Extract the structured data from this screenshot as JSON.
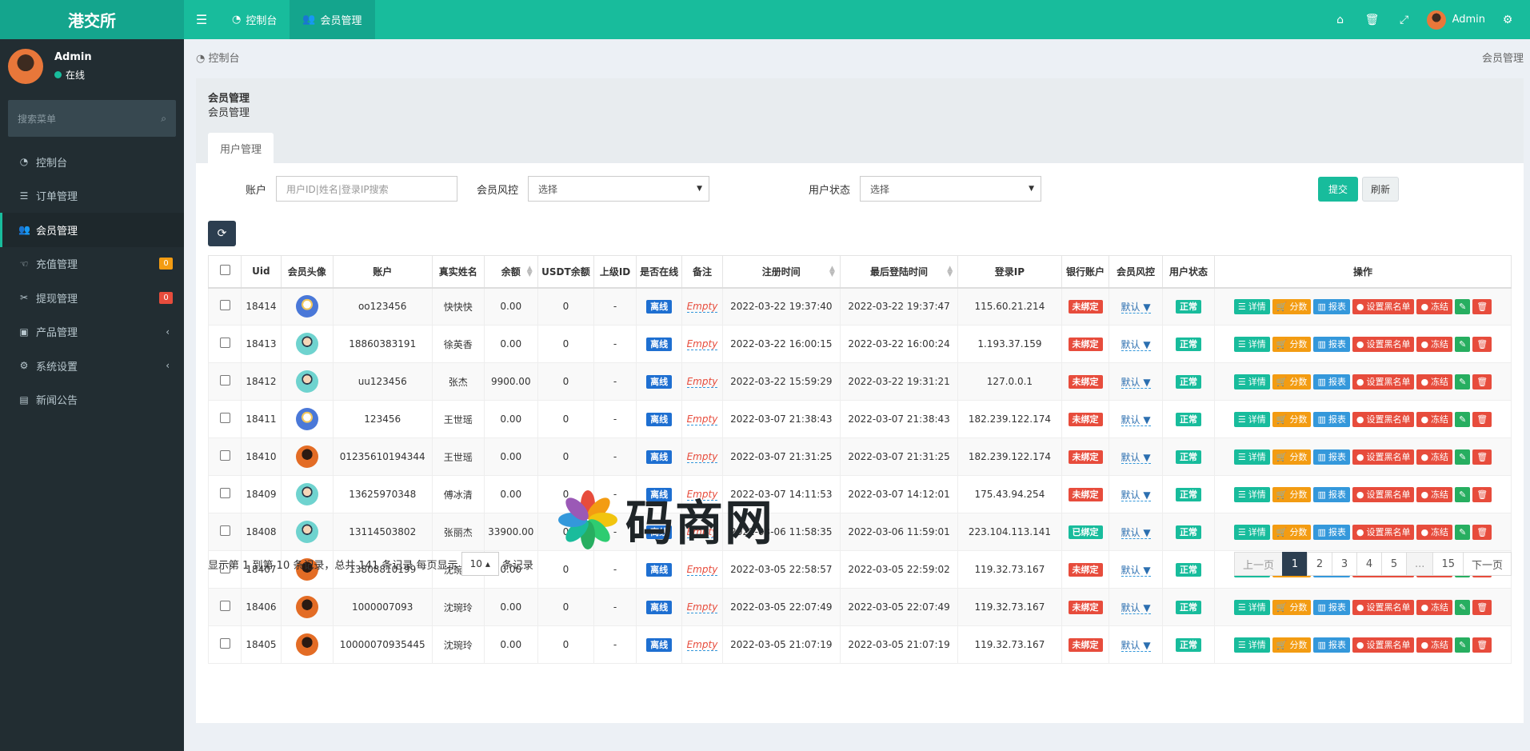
{
  "app": {
    "brand": "港交所"
  },
  "topbar": {
    "menu_icon": "bars-icon",
    "nav": [
      {
        "label": "控制台",
        "icon": "dashboard-icon",
        "active": false
      },
      {
        "label": "会员管理",
        "icon": "users-icon",
        "active": true
      }
    ],
    "right_icons": [
      "home-icon",
      "trash-icon",
      "fullscreen-icon"
    ],
    "user_name": "Admin",
    "settings_icon": "cogs-icon"
  },
  "sidebar": {
    "user_name": "Admin",
    "user_status": "在线",
    "search_placeholder": "搜索菜单",
    "items": [
      {
        "label": "控制台",
        "icon": "dashboard-icon"
      },
      {
        "label": "订单管理",
        "icon": "list-icon"
      },
      {
        "label": "会员管理",
        "icon": "users-icon",
        "active": true
      },
      {
        "label": "充值管理",
        "icon": "hand-icon",
        "badge": "0",
        "badge_color": "#f39c12"
      },
      {
        "label": "提现管理",
        "icon": "cut-icon",
        "badge": "0",
        "badge_color": "#e74c3c"
      },
      {
        "label": "产品管理",
        "icon": "briefcase-icon",
        "chevron": "‹"
      },
      {
        "label": "系统设置",
        "icon": "cogs-icon",
        "chevron": "‹"
      },
      {
        "label": "新闻公告",
        "icon": "newspaper-icon"
      }
    ]
  },
  "breadcrumb": {
    "left": "控制台",
    "right": "会员管理"
  },
  "panel": {
    "title": "会员管理",
    "subtitle": "会员管理",
    "tab": "用户管理"
  },
  "filters": {
    "account_label": "账户",
    "account_placeholder": "用户ID|姓名|登录IP搜索",
    "risk_label": "会员风控",
    "risk_value": "选择",
    "status_label": "用户状态",
    "status_value": "选择",
    "submit": "提交",
    "reset": "刷新"
  },
  "table": {
    "headers": [
      "Uid",
      "会员头像",
      "账户",
      "真实姓名",
      "余额",
      "USDT余额",
      "上级ID",
      "是否在线",
      "备注",
      "注册时间",
      "最后登陆时间",
      "登录IP",
      "银行账户",
      "会员风控",
      "用户状态",
      "操作"
    ],
    "op_labels": {
      "detail": "详情",
      "score": "分数",
      "report": "报表",
      "blacklist": "设置黑名单",
      "freeze": "冻结"
    },
    "rows": [
      {
        "uid": "18414",
        "avatar": "boy",
        "account": "oo123456",
        "name": "快快快",
        "balance": "0.00",
        "usdt": "0",
        "parent": "-",
        "online": "离线",
        "note": "Empty",
        "reg": "2022-03-22 19:37:40",
        "last": "2022-03-22 19:37:47",
        "ip": "115.60.21.214",
        "bank": "未绑定",
        "bank_color": "red",
        "risk": "默认 ▼",
        "status": "正常"
      },
      {
        "uid": "18413",
        "avatar": "teal",
        "account": "18860383191",
        "name": "徐英香",
        "balance": "0.00",
        "usdt": "0",
        "parent": "-",
        "online": "离线",
        "note": "Empty",
        "reg": "2022-03-22 16:00:15",
        "last": "2022-03-22 16:00:24",
        "ip": "1.193.37.159",
        "bank": "未绑定",
        "bank_color": "red",
        "risk": "默认 ▼",
        "status": "正常"
      },
      {
        "uid": "18412",
        "avatar": "teal",
        "account": "uu123456",
        "name": "张杰",
        "balance": "9900.00",
        "usdt": "0",
        "parent": "-",
        "online": "离线",
        "note": "Empty",
        "reg": "2022-03-22 15:59:29",
        "last": "2022-03-22 19:31:21",
        "ip": "127.0.0.1",
        "bank": "未绑定",
        "bank_color": "red",
        "risk": "默认 ▼",
        "status": "正常"
      },
      {
        "uid": "18411",
        "avatar": "boy",
        "account": "123456",
        "name": "王世瑶",
        "balance": "0.00",
        "usdt": "0",
        "parent": "-",
        "online": "离线",
        "note": "Empty",
        "reg": "2022-03-07 21:38:43",
        "last": "2022-03-07 21:38:43",
        "ip": "182.239.122.174",
        "bank": "未绑定",
        "bank_color": "red",
        "risk": "默认 ▼",
        "status": "正常"
      },
      {
        "uid": "18410",
        "avatar": "orange",
        "account": "01235610194344",
        "name": "王世瑶",
        "balance": "0.00",
        "usdt": "0",
        "parent": "-",
        "online": "离线",
        "note": "Empty",
        "reg": "2022-03-07 21:31:25",
        "last": "2022-03-07 21:31:25",
        "ip": "182.239.122.174",
        "bank": "未绑定",
        "bank_color": "red",
        "risk": "默认 ▼",
        "status": "正常"
      },
      {
        "uid": "18409",
        "avatar": "teal",
        "account": "13625970348",
        "name": "傅冰清",
        "balance": "0.00",
        "usdt": "0",
        "parent": "-",
        "online": "离线",
        "note": "Empty",
        "reg": "2022-03-07 14:11:53",
        "last": "2022-03-07 14:12:01",
        "ip": "175.43.94.254",
        "bank": "未绑定",
        "bank_color": "red",
        "risk": "默认 ▼",
        "status": "正常"
      },
      {
        "uid": "18408",
        "avatar": "teal",
        "account": "13114503802",
        "name": "张丽杰",
        "balance": "33900.00",
        "usdt": "0",
        "parent": "-",
        "online": "离线",
        "note": "Empty",
        "reg": "2022-03-06 11:58:35",
        "last": "2022-03-06 11:59:01",
        "ip": "223.104.113.141",
        "bank": "已绑定",
        "bank_color": "green",
        "risk": "默认 ▼",
        "status": "正常"
      },
      {
        "uid": "18407",
        "avatar": "orange",
        "account": "13808810199",
        "name": "沈琬玲",
        "balance": "0.00",
        "usdt": "0",
        "parent": "-",
        "online": "离线",
        "note": "Empty",
        "reg": "2022-03-05 22:58:57",
        "last": "2022-03-05 22:59:02",
        "ip": "119.32.73.167",
        "bank": "未绑定",
        "bank_color": "red",
        "risk": "默认 ▼",
        "status": "正常"
      },
      {
        "uid": "18406",
        "avatar": "orange",
        "account": "1000007093",
        "name": "沈琬玲",
        "balance": "0.00",
        "usdt": "0",
        "parent": "-",
        "online": "离线",
        "note": "Empty",
        "reg": "2022-03-05 22:07:49",
        "last": "2022-03-05 22:07:49",
        "ip": "119.32.73.167",
        "bank": "未绑定",
        "bank_color": "red",
        "risk": "默认 ▼",
        "status": "正常"
      },
      {
        "uid": "18405",
        "avatar": "orange",
        "account": "10000070935445",
        "name": "沈琬玲",
        "balance": "0.00",
        "usdt": "0",
        "parent": "-",
        "online": "离线",
        "note": "Empty",
        "reg": "2022-03-05 21:07:19",
        "last": "2022-03-05 21:07:19",
        "ip": "119.32.73.167",
        "bank": "未绑定",
        "bank_color": "red",
        "risk": "默认 ▼",
        "status": "正常"
      }
    ]
  },
  "footer": {
    "info_prefix": "显示第 1 到第 10 条记录，总共 141 条记录 每页显示",
    "page_size": "10",
    "info_suffix": "条记录",
    "pages": [
      {
        "label": "上一页",
        "state": "disabled"
      },
      {
        "label": "1",
        "state": "active"
      },
      {
        "label": "2"
      },
      {
        "label": "3"
      },
      {
        "label": "4"
      },
      {
        "label": "5"
      },
      {
        "label": "...",
        "state": "disabled"
      },
      {
        "label": "15"
      },
      {
        "label": "下一页"
      }
    ]
  },
  "watermark": {
    "text": "码商网"
  }
}
